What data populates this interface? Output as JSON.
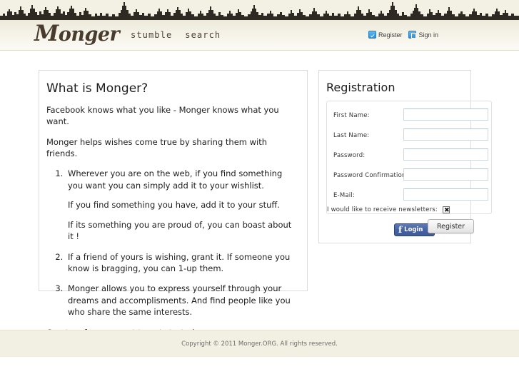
{
  "site": {
    "logo_text": "Monger",
    "logo_initial": "M",
    "logo_rest": "onger"
  },
  "header": {
    "nav": [
      {
        "label": "stumble",
        "name": "nav-stumble"
      },
      {
        "label": "search",
        "name": "nav-search"
      }
    ],
    "account": [
      {
        "label": "Register",
        "icon": "check-badge-icon"
      },
      {
        "label": "Sign in",
        "icon": "login-key-icon"
      }
    ]
  },
  "intro": {
    "title": "What is Monger?",
    "para1": "Facebook knows what you like - Monger knows what you want.",
    "para2": "Monger helps wishes come true by sharing them with friends.",
    "items": [
      {
        "main": "Wherever you are on the web, if you find something you want you can simply add it to your wishlist.",
        "sub1": "If you find something you have, add it to your stuff.",
        "sub2": "If its something you are proud of, you can boast about it !"
      },
      {
        "main": "If a friend of yours is wishing, grant it. If someone you know is bragging, you can 1-up them."
      },
      {
        "main": "Monger allows you to express yourself through your dreams and accomplisments. And find people like you who share the same interests."
      }
    ],
    "cta_link": "Create a free account",
    "cta_rest": " to get started."
  },
  "registration": {
    "title": "Registration",
    "fields": [
      {
        "label": "First Name:",
        "value": "",
        "name": "first-name"
      },
      {
        "label": "Last Name:",
        "value": "",
        "name": "last-name"
      },
      {
        "label": "Password:",
        "value": "",
        "name": "password"
      },
      {
        "label": "Password Confirmation:",
        "value": "",
        "name": "password-confirmation"
      },
      {
        "label": "E-Mail:",
        "value": "",
        "name": "email"
      }
    ],
    "newsletter_label": "I would like to receive newsletters:",
    "newsletter_checked": true,
    "facebook_button": "Login",
    "facebook_glyph": "f",
    "register_button": "Register"
  },
  "footer": {
    "copyright": "Copyright © 2011 Monger.ORG. All rights reserved."
  },
  "colors": {
    "cream": "#f3f1e4",
    "skyline": "#2e2a23",
    "logo_brown": "#4a3c2c",
    "facebook_blue": "#4763a0",
    "accent_blue": "#2a8fdc"
  }
}
